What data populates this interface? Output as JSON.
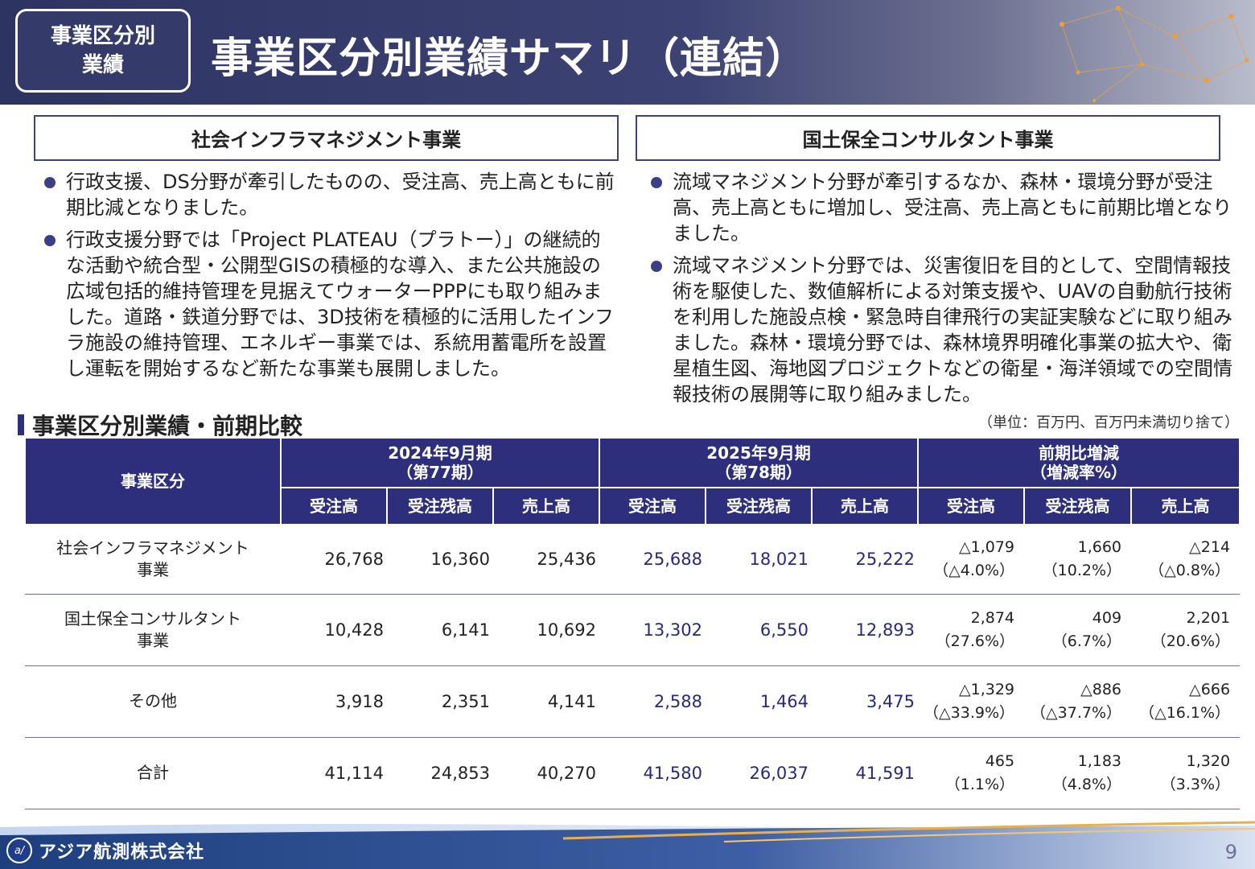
{
  "header": {
    "badge_line1": "事業区分別",
    "badge_line2": "業績",
    "title": "事業区分別業績サマリ（連結）"
  },
  "sections": {
    "left_title": "社会インフラマネジメント事業",
    "right_title": "国土保全コンサルタント事業"
  },
  "left_bullets": [
    "行政支援、DS分野が牽引したものの、受注高、売上高ともに前期比減となりました。",
    "行政支援分野では「Project PLATEAU（プラトー）」の継続的な活動や統合型・公開型GISの積極的な導入、また公共施設の広域包括的維持管理を見据えてウォーターPPPにも取り組みました。道路・鉄道分野では、3D技術を積極的に活用したインフラ施設の維持管理、エネルギー事業では、系統用蓄電所を設置し運転を開始するなど新たな事業も展開しました。"
  ],
  "right_bullets": [
    "流域マネジメント分野が牽引するなか、森林・環境分野が受注高、売上高ともに増加し、受注高、売上高ともに前期比増となりました。",
    "流域マネジメント分野では、災害復旧を目的として、空間情報技術を駆使した、数値解析による対策支援や、UAVの自動航行技術を利用した施設点検・緊急時自律飛行の実証実験などに取り組みました。森林・環境分野では、森林境界明確化事業の拡大や、衛星植生図、海地図プロジェクトなどの衛星・海洋領域での空間情報技術の展開等に取り組みました。"
  ],
  "table": {
    "heading": "事業区分別業績・前期比較",
    "unit_note": "（単位：百万円、百万円未満切り捨て）",
    "col_category": "事業区分",
    "period1_line1": "2024年9月期",
    "period1_line2": "（第77期）",
    "period2_line1": "2025年9月期",
    "period2_line2": "（第78期）",
    "diff_line1": "前期比増減",
    "diff_line2": "（増減率%）",
    "sub_orders": "受注高",
    "sub_backlog": "受注残高",
    "sub_sales": "売上高",
    "rows": [
      {
        "cat_line1": "社会インフラマネジメント",
        "cat_line2": "事業",
        "p1": [
          "26,768",
          "16,360",
          "25,436"
        ],
        "p2": [
          "25,688",
          "18,021",
          "25,222"
        ],
        "diff": [
          [
            "△1,079",
            "（△4.0%）"
          ],
          [
            "1,660",
            "（10.2%）"
          ],
          [
            "△214",
            "（△0.8%）"
          ]
        ]
      },
      {
        "cat_line1": "国土保全コンサルタント",
        "cat_line2": "事業",
        "p1": [
          "10,428",
          "6,141",
          "10,692"
        ],
        "p2": [
          "13,302",
          "6,550",
          "12,893"
        ],
        "diff": [
          [
            "2,874",
            "（27.6%）"
          ],
          [
            "409",
            "（6.7%）"
          ],
          [
            "2,201",
            "（20.6%）"
          ]
        ]
      },
      {
        "cat_line1": "その他",
        "cat_line2": "",
        "p1": [
          "3,918",
          "2,351",
          "4,141"
        ],
        "p2": [
          "2,588",
          "1,464",
          "3,475"
        ],
        "diff": [
          [
            "△1,329",
            "（△33.9%）"
          ],
          [
            "△886",
            "（△37.7%）"
          ],
          [
            "△666",
            "（△16.1%）"
          ]
        ]
      },
      {
        "cat_line1": "合計",
        "cat_line2": "",
        "p1": [
          "41,114",
          "24,853",
          "40,270"
        ],
        "p2": [
          "41,580",
          "26,037",
          "41,591"
        ],
        "diff": [
          [
            "465",
            "（1.1%）"
          ],
          [
            "1,183",
            "（4.8%）"
          ],
          [
            "1,320",
            "（3.3%）"
          ]
        ]
      }
    ]
  },
  "footer": {
    "company": "アジア航測株式会社",
    "page_number": "9"
  },
  "colors": {
    "header_navy": "#2e3462",
    "table_header": "#2d2f7c",
    "current_period_text": "#27297a",
    "bullet": "#3b3f85",
    "gold_accent": "#e8b04a"
  }
}
